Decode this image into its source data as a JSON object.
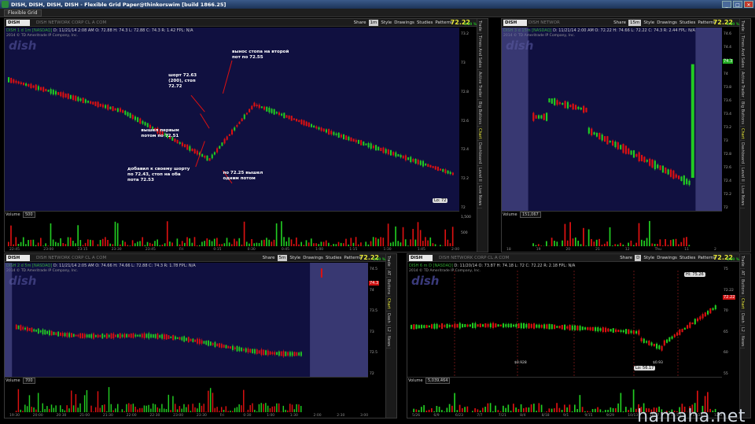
{
  "window": {
    "title": "DISH, DISH, DISH, DISH - Flexible Grid Paper@thinkorswim [build 1866.25]",
    "controls": [
      "_",
      "□",
      "✕"
    ]
  },
  "grid_label": "Flexible Grid",
  "common": {
    "symbol": "DISH",
    "description": "DISH NETWORK CORP CL A COM",
    "copyright": "2014 © TD Ameritrade IP Company, Inc.",
    "logo_text": "dish",
    "buttons": [
      "Share",
      "Style",
      "Drawings",
      "Studies",
      "Patterns"
    ],
    "last_price": "72.22",
    "pct_change": "0.09 %",
    "volume_label": "Volume"
  },
  "panes": [
    {
      "id": "tl",
      "timeframe": "1m",
      "header_sym": "DISH",
      "info_study": "DISH 1 d 1m [NASDAQ]",
      "info_values": "D: 11/21/14 2:08 AM   O: 72.88   H: 74.3   L: 72.88   C: 74.3   R: 1.42   FPL: N/A",
      "volume": "500",
      "y_ticks": [
        "73.2",
        "73",
        "72.8",
        "72.6",
        "72.4",
        "72.2",
        "72"
      ],
      "time_ticks": [
        "22:45",
        "23:00",
        "23:15",
        "23:30",
        "23:45",
        "Fri",
        "0:15",
        "0:30",
        "0:45",
        "1:00",
        "1:15",
        "1:30",
        "1:45",
        "2:00"
      ],
      "vol_ticks": [
        "1,500",
        "500"
      ],
      "low_badge": "Lo: 72",
      "side_tabs": [
        "Trade",
        "Times And Sales",
        "Active Trader",
        "Big Buttons",
        "Chart",
        "Dashboard",
        "Level II",
        "Live News"
      ],
      "annotations": [
        "шорт 72.63\n(200), стоп\n72.72",
        "вынос стопа на второй\nпот по 72.55",
        "вышел первым\nпотом по 72.51",
        "добавил к своему шорту\nпо 72.43, стоп на оба\nпота 72.53",
        "по 72.25 вышел\nодним потом"
      ]
    },
    {
      "id": "tr",
      "timeframe": "15m",
      "header_sym": "DISH",
      "info_study": "DISH 3 d 15m [NASDAQ]",
      "info_values": "D: 11/21/14 2:00 AM   O: 72.22   H: 74.66   L: 72.22   C: 74.3   R: 2.44   FPL: N/A",
      "volume": "151,067",
      "y_ticks": [
        "74.6",
        "74.4",
        "74.2",
        "74",
        "73.8",
        "73.6",
        "73.4",
        "73.2",
        "73",
        "72.8",
        "72.6",
        "72.4",
        "72.2",
        "72"
      ],
      "time_ticks": [
        "18",
        "19",
        "20",
        "21",
        "12",
        "Thu",
        "11",
        "2"
      ],
      "price_tag": "74.3",
      "side_tabs": [
        "Trade",
        "Times And Sales",
        "Active Trader",
        "Big Buttons",
        "Chart",
        "Dashboard",
        "Level II",
        "Live News"
      ]
    },
    {
      "id": "bl",
      "timeframe": "5m",
      "header_sym": "DISH",
      "info_study": "DISH 2 d 5m [NASDAQ]",
      "info_values": "D: 11/21/14 2:05 AM   O: 74.66   H: 74.66   L: 72.88   C: 74.3   R: 1.78   FPL: N/A",
      "volume": "700",
      "y_ticks": [
        "74.5",
        "74",
        "73.5",
        "73",
        "72.5",
        "72"
      ],
      "time_ticks": [
        "19:30",
        "20:00",
        "20:30",
        "21:00",
        "21:30",
        "22:00",
        "22:30",
        "23:00",
        "23:30",
        "Fri",
        "0:30",
        "1:00",
        "1:30",
        "2:00",
        "2:30",
        "3:00"
      ],
      "price_tag": "74.3",
      "side_tabs": [
        "Trade",
        "AT",
        "Buttons",
        "Chart",
        "Dash",
        "L2",
        "News"
      ]
    },
    {
      "id": "br",
      "timeframe": "D",
      "header_sym": "DISH",
      "info_study": "DISH 6 m D [NASDAQ]",
      "info_values": "D: 11/20/14   O: 73.87   H: 74.18   L: 72   C: 72.22   R: 2.18   FPL: N/A",
      "volume": "5,039,464",
      "y_ticks": [
        "75",
        "72.22",
        "70",
        "65",
        "60",
        "55"
      ],
      "time_ticks": [
        "5/26",
        "6/9",
        "6/23",
        "7/7",
        "7/21",
        "8/4",
        "8/18",
        "9/1",
        "9/15",
        "9/29",
        "10/13",
        "10/27",
        "11/10",
        "11/24",
        "12/8"
      ],
      "hi_badge": "Hi: 75.26",
      "lo_badge": "Lo: 56.17",
      "dividend_labels": [
        "$0.928",
        "$0.93"
      ],
      "side_tabs": [
        "Trade",
        "AT",
        "Buttons",
        "Chart",
        "Dash",
        "L2",
        "News"
      ]
    }
  ],
  "watermark": "hamaha.net",
  "colors": {
    "up": "#22cc22",
    "down": "#dd1111",
    "plot_bg": "#101040",
    "price": "#e8e838"
  }
}
